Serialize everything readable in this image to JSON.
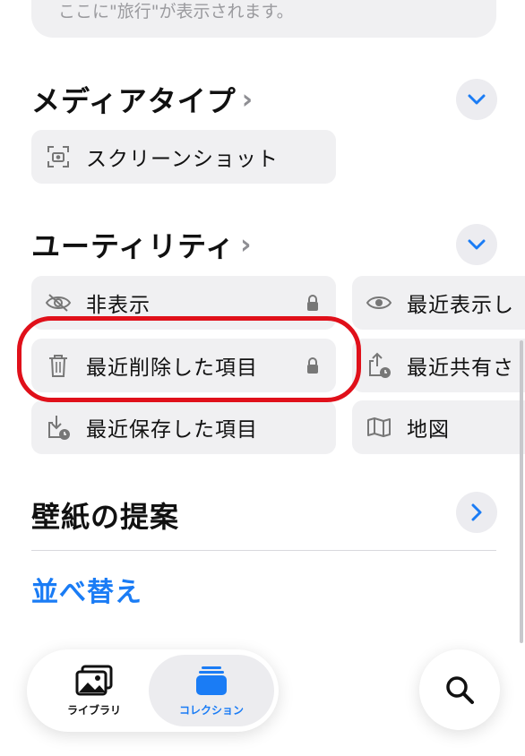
{
  "search_hint": {
    "text": "ここに\"旅行\"が表示されます。"
  },
  "media_types": {
    "title": "メディアタイプ",
    "items": [
      {
        "label": "スクリーンショット",
        "icon": "screenshot-icon"
      }
    ]
  },
  "utilities": {
    "title": "ユーティリティ",
    "items": [
      {
        "label": "非表示",
        "icon": "eye-slash-icon",
        "locked": true
      },
      {
        "label": "最近表示し",
        "icon": "eye-icon",
        "locked": false
      },
      {
        "label": "最近削除した項目",
        "icon": "trash-icon",
        "locked": true
      },
      {
        "label": "最近共有さ",
        "icon": "share-clock-icon",
        "locked": false
      },
      {
        "label": "最近保存した項目",
        "icon": "download-clock-icon",
        "locked": false
      },
      {
        "label": "地図",
        "icon": "map-icon",
        "locked": false
      }
    ]
  },
  "wallpaper": {
    "title": "壁紙の提案"
  },
  "sort": {
    "label": "並べ替え"
  },
  "tabbar": {
    "tabs": [
      {
        "label": "ライブラリ",
        "icon": "photos-icon",
        "active": false
      },
      {
        "label": "コレクション",
        "icon": "collections-icon",
        "active": true
      }
    ]
  },
  "colors": {
    "accent": "#1a7cf5",
    "highlight": "#e0101a",
    "tile_bg": "#f0f0f2"
  }
}
